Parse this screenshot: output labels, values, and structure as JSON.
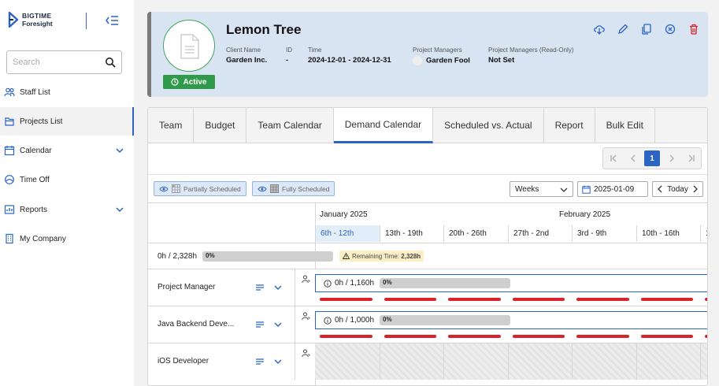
{
  "brand": {
    "line1": "BIGTIME",
    "line2": "Foresight"
  },
  "search": {
    "placeholder": "Search",
    "value": ""
  },
  "nav": [
    {
      "label": "Staff List",
      "icon": "people-icon",
      "active": false,
      "expandable": false
    },
    {
      "label": "Projects List",
      "icon": "folder-icon",
      "active": true,
      "expandable": false
    },
    {
      "label": "Calendar",
      "icon": "calendar-icon",
      "active": false,
      "expandable": true
    },
    {
      "label": "Time Off",
      "icon": "time-off-icon",
      "active": false,
      "expandable": false
    },
    {
      "label": "Reports",
      "icon": "report-icon",
      "active": false,
      "expandable": true
    },
    {
      "label": "My Company",
      "icon": "building-icon",
      "active": false,
      "expandable": false
    }
  ],
  "project": {
    "title": "Lemon Tree",
    "status": "Active",
    "client_label": "Client Name",
    "client_value": "Garden Inc.",
    "id_label": "ID",
    "id_value": "-",
    "time_label": "Time",
    "time_value": "2024-12-01 - 2024-12-31",
    "pm_label": "Project Managers",
    "pm_value": "Garden Fool",
    "pm_ro_label": "Project Managers (Read-Only)",
    "pm_ro_value": "Not Set",
    "actions": [
      "cloud-download-icon",
      "pencil-icon",
      "copy-icon",
      "cancel-circle-icon",
      "trash-icon"
    ]
  },
  "tabs": [
    "Team",
    "Budget",
    "Team Calendar",
    "Demand Calendar",
    "Scheduled vs. Actual",
    "Report",
    "Bulk Edit"
  ],
  "active_tab": "Demand Calendar",
  "pager": {
    "current": "1"
  },
  "legend": {
    "partial": "Partially Scheduled",
    "full": "Fully Scheduled"
  },
  "view": {
    "period": "Weeks",
    "date": "2025-01-09",
    "today_label": "Today"
  },
  "calendar": {
    "months": [
      "January 2025",
      "February 2025"
    ],
    "weeks": [
      "6th - 12th",
      "13th - 19th",
      "20th - 26th",
      "27th - 2nd",
      "3rd - 9th",
      "10th - 16th",
      "1"
    ],
    "summary": {
      "hours": "0h / 2,328h",
      "percent": "0%",
      "remaining_label": "Remaining Time:",
      "remaining_value": "2,328h"
    },
    "roles": [
      {
        "name": "Project Manager",
        "hours": "0h / 1,160h",
        "percent": "0%",
        "scheduled": true
      },
      {
        "name": "Java Backend Deve...",
        "hours": "0h / 1,000h",
        "percent": "0%",
        "scheduled": true
      },
      {
        "name": "iOS Developer",
        "hours": "",
        "percent": "",
        "scheduled": false
      }
    ]
  },
  "colors": {
    "accent": "#2a64c5",
    "active_green": "#2e9a4a",
    "demand_red": "#d9232a",
    "header_bg": "#d9e4f3"
  }
}
